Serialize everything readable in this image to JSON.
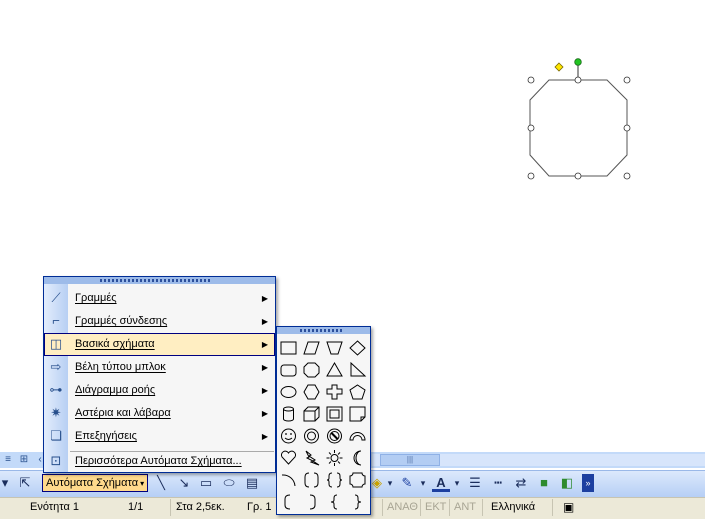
{
  "menu": {
    "items": [
      {
        "label": "Γραμμές",
        "icon": "lines-icon"
      },
      {
        "label": "Γραμμές σύνδεσης",
        "icon": "connectors-icon"
      },
      {
        "label": "Βασικά σχήματα",
        "icon": "basic-shapes-icon"
      },
      {
        "label": "Βέλη τύπου μπλοκ",
        "icon": "block-arrows-icon"
      },
      {
        "label": "Διάγραμμα ροής",
        "icon": "flowchart-icon"
      },
      {
        "label": "Αστέρια και λάβαρα",
        "icon": "stars-banners-icon"
      },
      {
        "label": "Επεξηγήσεις",
        "icon": "callouts-icon"
      },
      {
        "label": "Περισσότερα Αυτόματα Σχήματα...",
        "icon": "more-autoshapes-icon"
      }
    ],
    "highlighted_index": 2,
    "highlight_color": "#ffeec2"
  },
  "toolbar": {
    "autoshapes_label": "Αυτόματα Σχήματα",
    "font_color_letter": "A"
  },
  "status": {
    "section": "Ενότητα 1",
    "page": "1/1",
    "at": "Στα 2,5εκ.",
    "line": "Γρ. 1",
    "rec": "ΕΓΓ",
    "trk": "ΑΝΑΘ",
    "ext": "ΕΚΤ",
    "ovr": "ΑΝΤ",
    "language": "Ελληνικά"
  },
  "colors": {
    "accent": "#000080",
    "toolbar_bg": "#c3daf9",
    "statusbar_bg": "#ece9d8"
  }
}
